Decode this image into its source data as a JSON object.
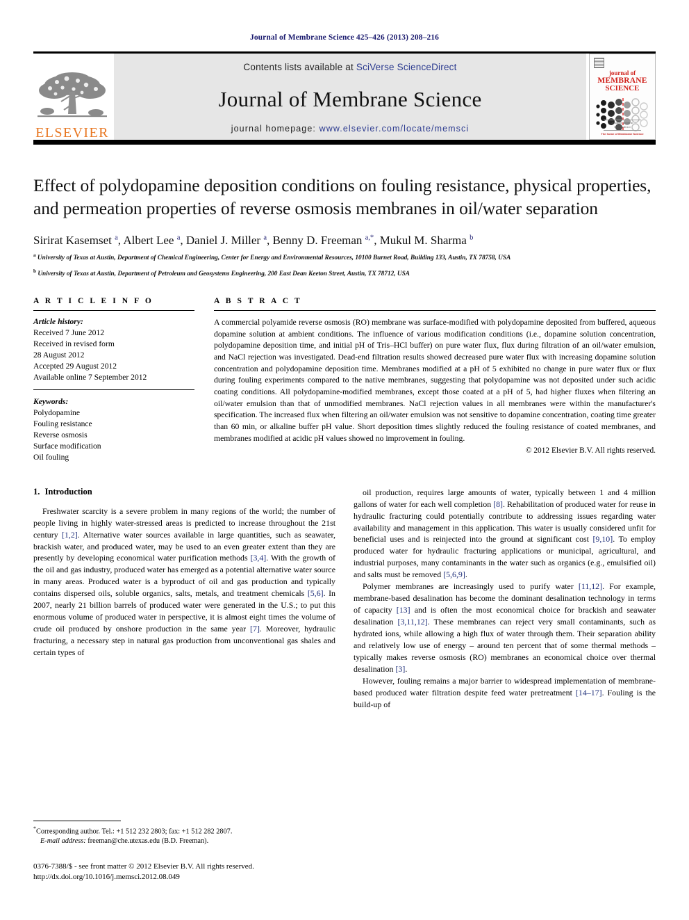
{
  "running_head": "Journal of Membrane Science 425–426 (2013) 208–216",
  "masthead": {
    "contents_prefix": "Contents lists available at ",
    "sciencedirect": "SciVerse ScienceDirect",
    "journal_title": "Journal of Membrane Science",
    "homepage_prefix": "journal homepage: ",
    "homepage_url": "www.elsevier.com/locate/memsci",
    "publisher_wordmark": "ELSEVIER",
    "publisher_color": "#E87722",
    "link_color": "#2b3a8f",
    "cover": {
      "line1": "journal of",
      "line2": "MEMBRANE",
      "line3": "SCIENCE",
      "color": "#d0201a",
      "foot_line1": "Available online at",
      "foot_line2": "ScienceDirect",
      "foot_line3": "The home of Membrane Science"
    }
  },
  "article": {
    "title": "Effect of polydopamine deposition conditions on fouling resistance, physical properties, and permeation properties of reverse osmosis membranes in oil/water separation",
    "authors_html": "Sirirat Kasemset <sup>a</sup>, Albert Lee <sup>a</sup>, Daniel J. Miller <sup>a</sup>, Benny D. Freeman <sup>a,*</sup>, Mukul M. Sharma <sup>b</sup>",
    "affiliations": [
      "University of Texas at Austin, Department of Chemical Engineering, Center for Energy and Environmental Resources, 10100 Burnet Road, Building 133, Austin, TX 78758, USA",
      "University of Texas at Austin, Department of Petroleum and Geosystems Engineering, 200 East Dean Keeton Street, Austin, TX 78712, USA"
    ],
    "affiliation_marks": [
      "a",
      "b"
    ]
  },
  "article_info": {
    "heading": "A R T I C L E   I N F O",
    "history_label": "Article history:",
    "history": [
      "Received 7 June 2012",
      "Received in revised form",
      "28 August 2012",
      "Accepted 29 August 2012",
      "Available online 7 September 2012"
    ],
    "keywords_label": "Keywords:",
    "keywords": [
      "Polydopamine",
      "Fouling resistance",
      "Reverse osmosis",
      "Surface modification",
      "Oil fouling"
    ]
  },
  "abstract": {
    "heading": "A B S T R A C T",
    "text": "A commercial polyamide reverse osmosis (RO) membrane was surface-modified with polydopamine deposited from buffered, aqueous dopamine solution at ambient conditions. The influence of various modification conditions (i.e., dopamine solution concentration, polydopamine deposition time, and initial pH of Tris–HCl buffer) on pure water flux, flux during filtration of an oil/water emulsion, and NaCl rejection was investigated. Dead-end filtration results showed decreased pure water flux with increasing dopamine solution concentration and polydopamine deposition time. Membranes modified at a pH of 5 exhibited no change in pure water flux or flux during fouling experiments compared to the native membranes, suggesting that polydopamine was not deposited under such acidic coating conditions. All polydopamine-modified membranes, except those coated at a pH of 5, had higher fluxes when filtering an oil/water emulsion than that of unmodified membranes. NaCl rejection values in all membranes were within the manufacturer's specification. The increased flux when filtering an oil/water emulsion was not sensitive to dopamine concentration, coating time greater than 60 min, or alkaline buffer pH value. Short deposition times slightly reduced the fouling resistance of coated membranes, and membranes modified at acidic pH values showed no improvement in fouling.",
    "copyright": "© 2012 Elsevier B.V. All rights reserved."
  },
  "body": {
    "section_number": "1.",
    "section_title": "Introduction",
    "left_column": [
      "Freshwater scarcity is a severe problem in many regions of the world; the number of people living in highly water-stressed areas is predicted to increase throughout the 21st century [1,2]. Alternative water sources available in large quantities, such as seawater, brackish water, and produced water, may be used to an even greater extent than they are presently by developing economical water purification methods [3,4]. With the growth of the oil and gas industry, produced water has emerged as a potential alternative water source in many areas. Produced water is a byproduct of oil and gas production and typically contains dispersed oils, soluble organics, salts, metals, and treatment chemicals [5,6]. In 2007, nearly 21 billion barrels of produced water were generated in the U.S.; to put this enormous volume of produced water in perspective, it is almost eight times the volume of crude oil produced by onshore production in the same year [7]. Moreover, hydraulic fracturing, a necessary step in natural gas production from unconventional gas shales and certain types of"
    ],
    "right_column": [
      "oil production, requires large amounts of water, typically between 1 and 4 million gallons of water for each well completion [8]. Rehabilitation of produced water for reuse in hydraulic fracturing could potentially contribute to addressing issues regarding water availability and management in this application. This water is usually considered unfit for beneficial uses and is reinjected into the ground at significant cost [9,10]. To employ produced water for hydraulic fracturing applications or municipal, agricultural, and industrial purposes, many contaminants in the water such as organics (e.g., emulsified oil) and salts must be removed [5,6,9].",
      "Polymer membranes are increasingly used to purify water [11,12]. For example, membrane-based desalination has become the dominant desalination technology in terms of capacity [13] and is often the most economical choice for brackish and seawater desalination [3,11,12]. These membranes can reject very small contaminants, such as hydrated ions, while allowing a high flux of water through them. Their separation ability and relatively low use of energy – around ten percent that of some thermal methods – typically makes reverse osmosis (RO) membranes an economical choice over thermal desalination [3].",
      "However, fouling remains a major barrier to widespread implementation of membrane-based produced water filtration despite feed water pretreatment [14–17]. Fouling is the build-up of"
    ]
  },
  "footnotes": {
    "corresponding": "Corresponding author. Tel.: +1 512 232 2803; fax: +1 512 282 2807.",
    "email_label": "E-mail address:",
    "email": "freeman@che.utexas.edu (B.D. Freeman).",
    "issn_line": "0376-7388/$ - see front matter © 2012 Elsevier B.V. All rights reserved.",
    "doi_line": "http://dx.doi.org/10.1016/j.memsci.2012.08.049"
  }
}
